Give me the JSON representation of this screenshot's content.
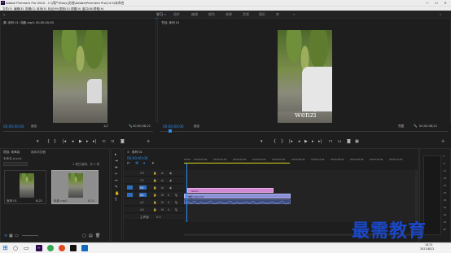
{
  "window": {
    "title": "Adobe Premiere Pro 2020 - C:\\用户\\Eboy\\文档\\Adobe\\Premiere Pro\\14.0\\未命名",
    "minimize": "—",
    "maximize": "☐",
    "close": "✕"
  },
  "menu": [
    "文件(F)",
    "编辑(E)",
    "剪辑(C)",
    "序列(S)",
    "标记(M)",
    "图形(G)",
    "视图(V)",
    "窗口(W)",
    "帮助(H)"
  ],
  "workspaces": [
    "学习",
    "组件",
    "编辑",
    "颜色",
    "效果",
    "音频",
    "图形",
    "库"
  ],
  "active_workspace": "学习",
  "source_monitor": {
    "title": "源: 序列 01: 电影.mp4: 00;00;00;00",
    "timecode": "00;00;00;00",
    "fit": "适合",
    "scale": "1/2",
    "duration": "00;00;08;22"
  },
  "program_monitor": {
    "title": "节目: 序列 01",
    "timecode": "00;00;00;00",
    "fit": "适合",
    "scale": "完整",
    "duration": "00;00;08;22",
    "overlay_text": "wenzi"
  },
  "project_panel": {
    "title": "项目: 未命名",
    "tab2": "媒体浏览器",
    "project_file": "未命名.prproj",
    "search_placeholder": "",
    "item_count": "1 项已选择，共 2 项",
    "items": [
      {
        "name": "序列 01",
        "duration": "8;22"
      },
      {
        "name": "电影.mp4",
        "duration": "8;22"
      }
    ]
  },
  "timeline": {
    "title": "序列 01",
    "timecode": "00;00;00;00",
    "ruler": [
      "00;00",
      "00;00;01;00",
      "00;00;02;00",
      "00;00;03;00",
      "00;00;04;00",
      "00;00;05;00",
      "00;00;06;00",
      "00;00;07;00",
      "00;00;08;00",
      "00;00;09;00",
      "00;00;10;00",
      "00;00;11;00"
    ],
    "tracks_video": [
      "V3",
      "V2",
      "V1"
    ],
    "tracks_audio": [
      "A1",
      "A2",
      "A3"
    ],
    "master": "主声道",
    "master_value": "0.0",
    "clips": [
      {
        "track": "V2",
        "label": "wenzi"
      },
      {
        "track": "V1",
        "label": "电影.mp4 [V]"
      },
      {
        "track": "A1",
        "label": ""
      }
    ]
  },
  "meter_labels": [
    "0",
    "-6",
    "-12",
    "-18",
    "-24",
    "-30",
    "-36",
    "-42",
    "-48",
    "-54",
    "dB"
  ],
  "taskbar": {
    "time": "14:21",
    "date": "2021/8/22"
  },
  "watermark": "最需教育"
}
